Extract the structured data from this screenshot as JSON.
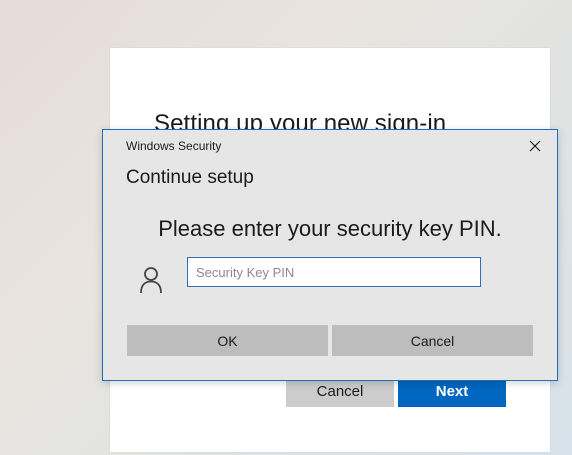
{
  "background_wizard": {
    "title": "Setting up your new sign-in",
    "cancel_label": "Cancel",
    "next_label": "Next",
    "accent_color": "#0067c0"
  },
  "dialog": {
    "header": "Windows Security",
    "close_icon": "close-icon",
    "heading": "Continue setup",
    "message": "Please enter your security key PIN.",
    "user_icon": "user-icon",
    "pin_input": {
      "placeholder": "Security Key PIN",
      "value": ""
    },
    "ok_label": "OK",
    "cancel_label": "Cancel",
    "border_color": "#1f6fbd"
  }
}
